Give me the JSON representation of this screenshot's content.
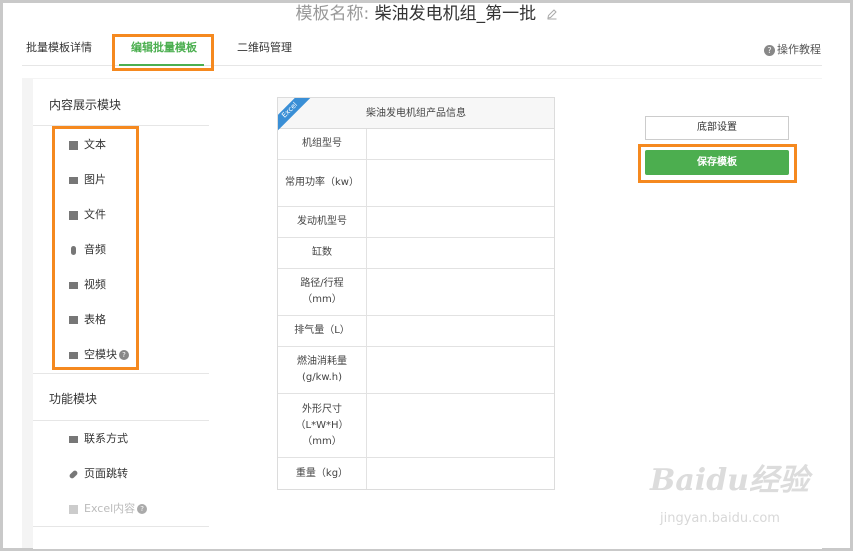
{
  "header": {
    "title_prefix": "模板名称:",
    "title_name": "柴油发电机组_第一批"
  },
  "tabs": [
    {
      "label": "批量模板详情"
    },
    {
      "label": "编辑批量模板"
    },
    {
      "label": "二维码管理"
    }
  ],
  "help_link": "操作教程",
  "left_panel": {
    "content_section_title": "内容展示模块",
    "content_items": [
      {
        "label": "文本"
      },
      {
        "label": "图片"
      },
      {
        "label": "文件"
      },
      {
        "label": "音频"
      },
      {
        "label": "视频"
      },
      {
        "label": "表格"
      },
      {
        "label": "空模块"
      }
    ],
    "function_section_title": "功能模块",
    "function_items": [
      {
        "label": "联系方式"
      },
      {
        "label": "页面跳转"
      },
      {
        "label": "Excel内容"
      }
    ]
  },
  "table": {
    "badge": "Excel",
    "title": "柴油发电机组产品信息",
    "rows": [
      {
        "label": "机组型号"
      },
      {
        "label": "常用功率（kw）"
      },
      {
        "label": "发动机型号"
      },
      {
        "label": "缸数"
      },
      {
        "label": "路径/行程（mm）"
      },
      {
        "label": "排气量（L）"
      },
      {
        "label": "燃油消耗量(g/kw.h)"
      },
      {
        "label": "外形尺寸（L*W*H）（mm）"
      },
      {
        "label": "重量（kg）"
      }
    ]
  },
  "right_panel": {
    "bottom_settings_label": "底部设置",
    "save_label": "保存模板"
  },
  "watermark": {
    "brand": "Baidu经验",
    "url": "jingyan.baidu.com"
  },
  "colors": {
    "accent_green": "#4caf50",
    "highlight_orange": "#f5891f",
    "excel_badge_blue": "#3a8fd6"
  }
}
